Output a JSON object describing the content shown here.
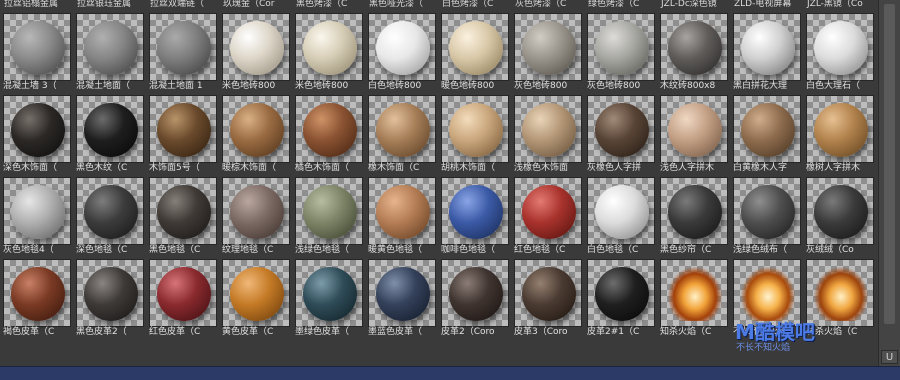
{
  "top_labels": [
    "拉丝铝榻金属",
    "拉丝银珏金属",
    "拉丝双端链（",
    "玖瑰金（Cor",
    "黑色烤漆（C",
    "黑色哑光漆（",
    "白色烤漆（C",
    "灰色烤漆（C",
    "绿色烤漆（C",
    "JZL-Dc深色镜",
    "ZLD-电视屏幕",
    "JZL-黑镜（Co"
  ],
  "rows": [
    [
      {
        "label": "混凝土墙 3（",
        "color": "#8a8a8a",
        "hl": "#b8b8b8",
        "dk": "#3e3e3e"
      },
      {
        "label": "混凝土地面（",
        "color": "#858585",
        "hl": "#b0b0b0",
        "dk": "#3b3b3b"
      },
      {
        "label": "混凝土地面 1",
        "color": "#7e7e7e",
        "hl": "#aaaaaa",
        "dk": "#383838"
      },
      {
        "label": "米色地砖800",
        "color": "#ddd6c8",
        "hl": "#ffffff",
        "dk": "#8e8676"
      },
      {
        "label": "米色地砖800",
        "color": "#d6cdb6",
        "hl": "#fbf7ee",
        "dk": "#8a7f66"
      },
      {
        "label": "白色地砖800",
        "color": "#e8e8e8",
        "hl": "#ffffff",
        "dk": "#8f8f8f"
      },
      {
        "label": "暖色地砖800",
        "color": "#d8c8a8",
        "hl": "#fbf1df",
        "dk": "#86744f"
      },
      {
        "label": "灰色地砖800",
        "color": "#9a958c",
        "hl": "#d2cdc4",
        "dk": "#4b4740"
      },
      {
        "label": "灰色地砖800",
        "color": "#a7a7a2",
        "hl": "#dddcd8",
        "dk": "#52524d"
      },
      {
        "label": "木纹砖800x8",
        "color": "#5f5c5a",
        "hl": "#a8a4a0",
        "dk": "#242221"
      },
      {
        "label": "黑白拼花大理",
        "color": "#d0d0d0",
        "hl": "#ffffff",
        "dk": "#6b6b6b"
      },
      {
        "label": "白色大理石（",
        "color": "#dcdcdc",
        "hl": "#ffffff",
        "dk": "#7a7a7a"
      }
    ],
    [
      {
        "label": "深色木饰面（",
        "color": "#2b2826",
        "hl": "#77706a",
        "dk": "#0c0b0a"
      },
      {
        "label": "黑色木纹（C",
        "color": "#1e1e1e",
        "hl": "#6c6c6c",
        "dk": "#060606"
      },
      {
        "label": "木饰面5号（",
        "color": "#6a4a2c",
        "hl": "#b9946a",
        "dk": "#2a1a0c"
      },
      {
        "label": "暖棕木饰面（",
        "color": "#9a6b42",
        "hl": "#d9b085",
        "dk": "#4a2e16"
      },
      {
        "label": "橘色木饰面（",
        "color": "#8a5232",
        "hl": "#cf9367",
        "dk": "#40200e"
      },
      {
        "label": "橡木饰面（C",
        "color": "#a67e58",
        "hl": "#e2c19c",
        "dk": "#55391f"
      },
      {
        "label": "胡桃木饰面（",
        "color": "#c9a67c",
        "hl": "#f3dcbc",
        "dk": "#6f5130"
      },
      {
        "label": "浅橡色木饰面",
        "color": "#b39676",
        "hl": "#e9d4b9",
        "dk": "#5f4a32"
      },
      {
        "label": "灰橡色人字拼",
        "color": "#584436",
        "hl": "#a08a78",
        "dk": "#221811"
      },
      {
        "label": "浅色人字拼木",
        "color": "#c29f84",
        "hl": "#f0d8c4",
        "dk": "#6b4f3a"
      },
      {
        "label": "白黄橡木人字",
        "color": "#8e6c4e",
        "hl": "#d0ad8b",
        "dk": "#43301e"
      },
      {
        "label": "橡树人字拼木",
        "color": "#b1824c",
        "hl": "#e7c092",
        "dk": "#5b3d1c"
      }
    ],
    [
      {
        "label": "灰色地毯4（",
        "color": "#b0b0b0",
        "hl": "#e6e6e6",
        "dk": "#5a5a5a"
      },
      {
        "label": "深色地毯（C",
        "color": "#3c3c3c",
        "hl": "#7d7d7d",
        "dk": "#141414"
      },
      {
        "label": "黑色地毯（C",
        "color": "#3f3a36",
        "hl": "#86807a",
        "dk": "#161311"
      },
      {
        "label": "纹理地毯（C",
        "color": "#7c6a64",
        "hl": "#b9a7a0",
        "dk": "#3a2c27"
      },
      {
        "label": "浅绿色地毯（",
        "color": "#7d8467",
        "hl": "#b6bda0",
        "dk": "#383d29"
      },
      {
        "label": "暖黄色地毯（",
        "color": "#b47d55",
        "hl": "#e6b48d",
        "dk": "#5c371c"
      },
      {
        "label": "咖啡色地毯（",
        "color": "#3b5aa6",
        "hl": "#8aa4e6",
        "dk": "#15254e"
      },
      {
        "label": "红色地毯（C",
        "color": "#a8322c",
        "hl": "#e37a72",
        "dk": "#4f100c"
      },
      {
        "label": "白色地毯（C",
        "color": "#dcdcdc",
        "hl": "#ffffff",
        "dk": "#7b7b7b"
      },
      {
        "label": "黑色纱帘（C",
        "color": "#3a3a3a",
        "hl": "#7a7a7a",
        "dk": "#111111"
      },
      {
        "label": "浅绿色绒布（",
        "color": "#4e4e4e",
        "hl": "#8f8f8f",
        "dk": "#181818"
      },
      {
        "label": "灰绒绒（Co",
        "color": "#3b3b3b",
        "hl": "#7a7a7a",
        "dk": "#121212"
      }
    ],
    [
      {
        "label": "褐色皮革（C",
        "color": "#7a3a24",
        "hl": "#c98067",
        "dk": "#33140a"
      },
      {
        "label": "黑色皮革2（",
        "color": "#3e3a38",
        "hl": "#8a8581",
        "dk": "#141211"
      },
      {
        "label": "红色皮革（C",
        "color": "#8a2a2e",
        "hl": "#d67479",
        "dk": "#3a0c0f"
      },
      {
        "label": "黄色皮革（C",
        "color": "#c47a26",
        "hl": "#f0b878",
        "dk": "#653708"
      },
      {
        "label": "墨绿色皮革（",
        "color": "#2f4c58",
        "hl": "#7d9caa",
        "dk": "#0e1d23"
      },
      {
        "label": "墨蓝色皮革（",
        "color": "#34415a",
        "hl": "#7f8faa",
        "dk": "#101726"
      },
      {
        "label": "皮革2（Coro",
        "color": "#3f3430",
        "hl": "#8b7c76",
        "dk": "#16100d"
      },
      {
        "label": "皮革3（Coro",
        "color": "#4a3b32",
        "hl": "#958070",
        "dk": "#1a120c"
      },
      {
        "label": "皮革2#1（C",
        "color": "#1f1f1f",
        "hl": "#6d6d6d",
        "dk": "#050505"
      },
      {
        "label": "知杀火焰（C",
        "color": "#f2a43a",
        "hl": "#fff1c8",
        "dk": "#a2400a",
        "fx": true
      },
      {
        "label": "不长不知火焰",
        "color": "#f6b24a",
        "hl": "#fff3cf",
        "dk": "#a84a0c",
        "fx": true
      },
      {
        "label": "长杀火焰（C",
        "color": "#f0a640",
        "hl": "#fff0c4",
        "dk": "#9c430d",
        "fx": true
      }
    ]
  ],
  "watermark": {
    "text": "M酷模吧",
    "sub": "不长不知火焰"
  },
  "scroll_button": "U"
}
